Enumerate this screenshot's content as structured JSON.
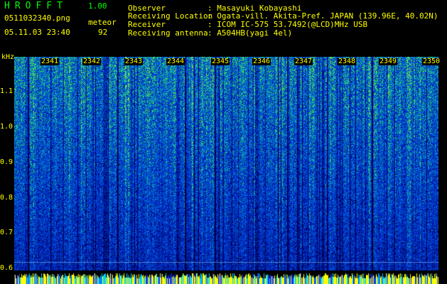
{
  "header": {
    "app_name": "HROFFT",
    "version": "1.00",
    "filename": "0511032340.png",
    "mode": "meteor",
    "datetime": "05.11.03 23:40",
    "count": "92"
  },
  "info": [
    {
      "label": "Observer",
      "value": ": Masayuki Kobayashi"
    },
    {
      "label": "Receiving Location",
      "value": ": Ogata-vill. Akita-Pref. JAPAN (139.96E, 40.02N)"
    },
    {
      "label": "Receiver",
      "value": ": ICOM IC-575 53.7492(@LCD)MHz USB"
    },
    {
      "label": "Receiving antenna",
      "value": ": A504HB(yagi 4el)"
    }
  ],
  "axis": {
    "unit": "kHz",
    "ticks": [
      "1.1",
      "1.0",
      "0.9",
      "0.8",
      "0.7",
      "0.6"
    ]
  },
  "time_marks": [
    "2341",
    "2342",
    "2343",
    "2344",
    "2345",
    "2346",
    "2347",
    "2348",
    "2349",
    "2350"
  ],
  "colors": {
    "label_yellow": "#ffff00",
    "title_green": "#00ff00",
    "background": "#000000"
  }
}
